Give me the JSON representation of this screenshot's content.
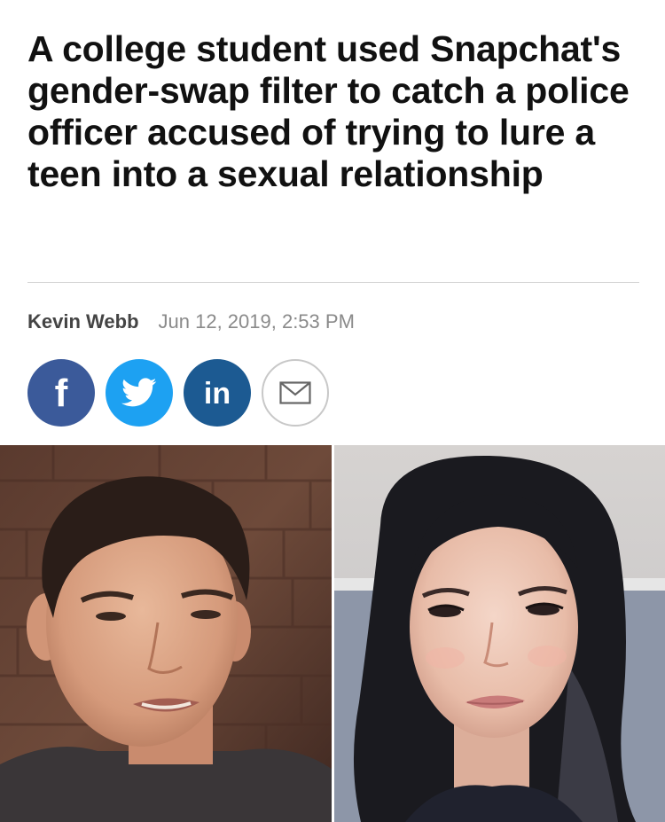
{
  "article": {
    "headline": "A college student used Snapchat's gender-swap filter to catch a police officer accused of trying to lure a teen into a sexual relationship",
    "author": "Kevin Webb",
    "date": "Jun 12, 2019, 2:53 PM"
  },
  "share": {
    "facebook_glyph": "f",
    "linkedin_glyph": "in",
    "icons": [
      "facebook-icon",
      "twitter-icon",
      "linkedin-icon",
      "email-icon"
    ],
    "colors": {
      "facebook": "#3b5a9a",
      "twitter": "#1da1f2",
      "linkedin": "#1c5a92",
      "email_border": "#c8c8c8"
    }
  },
  "images": {
    "left": "photo-young-man",
    "right": "photo-gender-swap-filter"
  }
}
